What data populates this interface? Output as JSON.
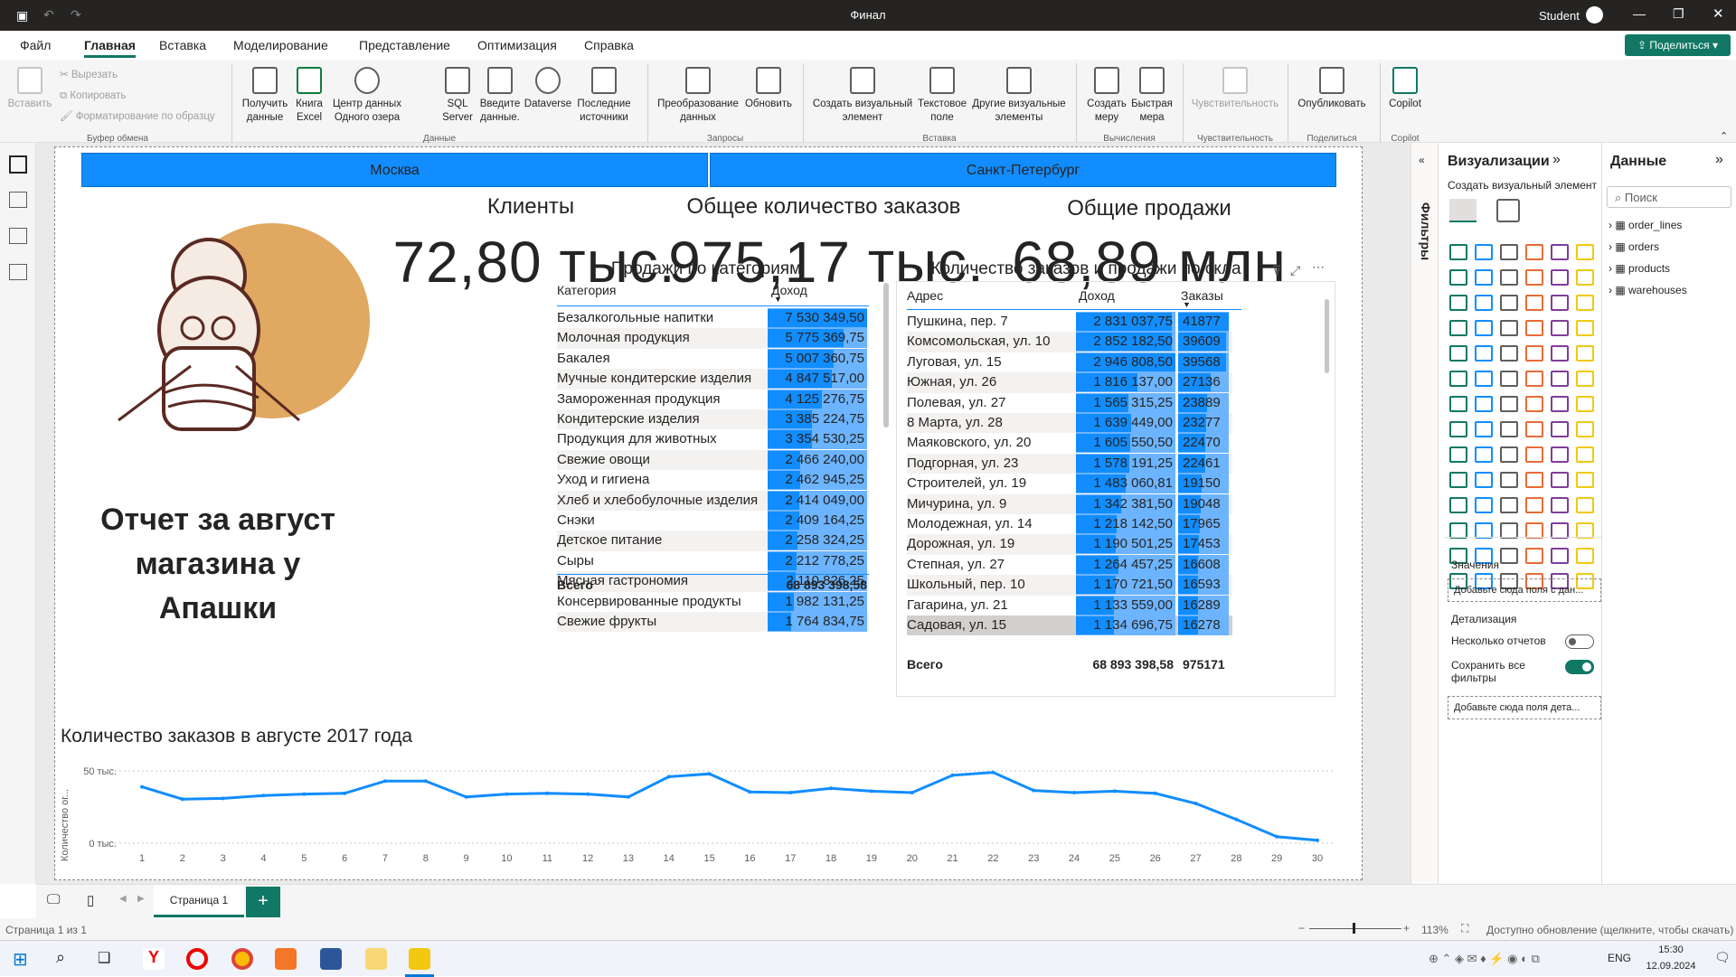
{
  "window": {
    "title": "Финал",
    "user": "Student",
    "share": "Поделиться"
  },
  "tabs": [
    "Файл",
    "Главная",
    "Вставка",
    "Моделирование",
    "Представление",
    "Оптимизация",
    "Справка"
  ],
  "ribbon": {
    "clipboard": {
      "paste": "Вставить",
      "cut": "Вырезать",
      "copy": "Копировать",
      "format": "Форматирование по образцу",
      "group": "Буфер обмена"
    },
    "data": {
      "get": "Получить данные",
      "excel": "Книга Excel",
      "hub": "Центр данных Одного озера",
      "sql": "SQL Server",
      "enter": "Введите данные.",
      "dataverse": "Dataverse",
      "recent": "Последние источники",
      "group": "Данные"
    },
    "queries": {
      "transform": "Преобразование данных",
      "refresh": "Обновить",
      "group": "Запросы"
    },
    "insert": {
      "newvis": "Создать визуальный элемент",
      "textbox": "Текстовое поле",
      "morevis": "Другие визуальные элементы",
      "group": "Вставка"
    },
    "calc": {
      "measure": "Создать меру",
      "quick": "Быстрая мера",
      "group": "Вычисления"
    },
    "sens": {
      "label": "Чувствительность",
      "group": "Чувствительность"
    },
    "share": {
      "publish": "Опубликовать",
      "group": "Поделиться"
    },
    "copilot": {
      "label": "Copilot",
      "group": "Copilot"
    }
  },
  "report": {
    "cities": [
      "Москва",
      "Санкт-Петербург"
    ],
    "kpis": [
      {
        "title": "Клиенты",
        "value": "72,80 тыс."
      },
      {
        "title": "Общее количество заказов",
        "value": "975,17 тыс."
      },
      {
        "title": "Общие продажи",
        "value": "68,89 млн"
      }
    ],
    "report_title": "Отчет за август магазина у Апашки",
    "cat_table": {
      "title": "Продажи по категориям",
      "col1": "Категория",
      "col2": "Доход",
      "total_label": "Всего",
      "total": "68 893 398,58",
      "rows": [
        [
          "Безалкогольные напитки",
          "7 530 349,50",
          7530349.5
        ],
        [
          "Молочная продукция",
          "5 775 369,75",
          5775369.75
        ],
        [
          "Бакалея",
          "5 007 360,75",
          5007360.75
        ],
        [
          "Мучные кондитерские изделия",
          "4 847 517,00",
          4847517
        ],
        [
          "Замороженная продукция",
          "4 125 276,75",
          4125276.75
        ],
        [
          "Кондитерские изделия",
          "3 385 224,75",
          3385224.75
        ],
        [
          "Продукция для животных",
          "3 354 530,25",
          3354530.25
        ],
        [
          "Свежие овощи",
          "2 466 240,00",
          2466240
        ],
        [
          "Уход и гигиена",
          "2 462 945,25",
          2462945.25
        ],
        [
          "Хлеб и хлебобулочные изделия",
          "2 414 049,00",
          2414049
        ],
        [
          "Снэки",
          "2 409 164,25",
          2409164.25
        ],
        [
          "Детское питание",
          "2 258 324,25",
          2258324.25
        ],
        [
          "Сыры",
          "2 212 778,25",
          2212778.25
        ],
        [
          "Мясная гастрономия",
          "2 110 826,25",
          2110826.25
        ],
        [
          "Консервированные продукты",
          "1 982 131,25",
          1982131.25
        ],
        [
          "Свежие фрукты",
          "1 764 834,75",
          1764834.75
        ]
      ]
    },
    "wh_table": {
      "title": "Количество заказов и продажи по скла",
      "col1": "Адрес",
      "col2": "Доход",
      "col3": "Заказы",
      "total_label": "Всего",
      "total": "68 893 398,58",
      "total_orders": "975171",
      "rows": [
        [
          "Пушкина, пер. 7",
          "2 831 037,75",
          2831037.75,
          "41877"
        ],
        [
          "Комсомольская, ул. 10",
          "2 852 182,50",
          2852182.5,
          "39609"
        ],
        [
          "Луговая, ул. 15",
          "2 946 808,50",
          2946808.5,
          "39568"
        ],
        [
          "Южная, ул. 26",
          "1 816 137,00",
          1816137,
          "27136"
        ],
        [
          "Полевая, ул. 27",
          "1 565 315,25",
          1565315.25,
          "23889"
        ],
        [
          "8 Марта, ул. 28",
          "1 639 449,00",
          1639449,
          "23277"
        ],
        [
          "Маяковского, ул. 20",
          "1 605 550,50",
          1605550.5,
          "22470"
        ],
        [
          "Подгорная, ул. 23",
          "1 578 191,25",
          1578191.25,
          "22461"
        ],
        [
          "Строителей, ул. 19",
          "1 483 060,81",
          1483060.81,
          "19150"
        ],
        [
          "Мичурина, ул. 9",
          "1 342 381,50",
          1342381.5,
          "19048"
        ],
        [
          "Молодежная, ул. 14",
          "1 218 142,50",
          1218142.5,
          "17965"
        ],
        [
          "Дорожная, ул. 19",
          "1 190 501,25",
          1190501.25,
          "17453"
        ],
        [
          "Степная, ул. 27",
          "1 264 457,25",
          1264457.25,
          "16608"
        ],
        [
          "Школьный, пер. 10",
          "1 170 721,50",
          1170721.5,
          "16593"
        ],
        [
          "Гагарина, ул. 21",
          "1 133 559,00",
          1133559,
          "16289"
        ],
        [
          "Садовая, ул. 15",
          "1 134 696,75",
          1134696.75,
          "16278"
        ]
      ]
    }
  },
  "chart_data": {
    "type": "line",
    "title": "Количество заказов в августе 2017 года",
    "ylabel": "Количество ог...",
    "yticks": [
      "50 тыс.",
      "0 тыс."
    ],
    "ylim": [
      0,
      55000
    ],
    "x": [
      1,
      2,
      3,
      4,
      5,
      6,
      7,
      8,
      9,
      10,
      11,
      12,
      13,
      14,
      15,
      16,
      17,
      18,
      19,
      20,
      21,
      22,
      23,
      24,
      25,
      26,
      27,
      28,
      29,
      30
    ],
    "values": [
      39000,
      30500,
      31000,
      33000,
      34000,
      34500,
      43000,
      43000,
      32000,
      34000,
      34500,
      34000,
      32000,
      46000,
      48000,
      35500,
      35000,
      38000,
      36000,
      35000,
      47000,
      49000,
      36500,
      35000,
      36000,
      34500,
      27500,
      16500,
      4500,
      2000
    ]
  },
  "viz_pane": {
    "title": "Визуализации",
    "create": "Создать визуальный элемент",
    "values": "Значения",
    "values_well": "Добавьте сюда поля с дан...",
    "drill": "Детализация",
    "cross": "Несколько отчетов",
    "keep": "Сохранить все фильтры",
    "drill_well": "Добавьте сюда поля дета...",
    "filters": "Фильтры"
  },
  "data_pane": {
    "title": "Данные",
    "search": "Поиск",
    "tables": [
      "order_lines",
      "orders",
      "products",
      "warehouses"
    ]
  },
  "pages": {
    "tab": "Страница 1",
    "add": "+"
  },
  "status": {
    "page": "Страница 1 из 1",
    "zoom": "113%",
    "update": "Доступно обновление (щелкните, чтобы скачать)"
  },
  "taskbar": {
    "lang": "ENG",
    "time": "15:30",
    "date": "12.09.2024"
  }
}
